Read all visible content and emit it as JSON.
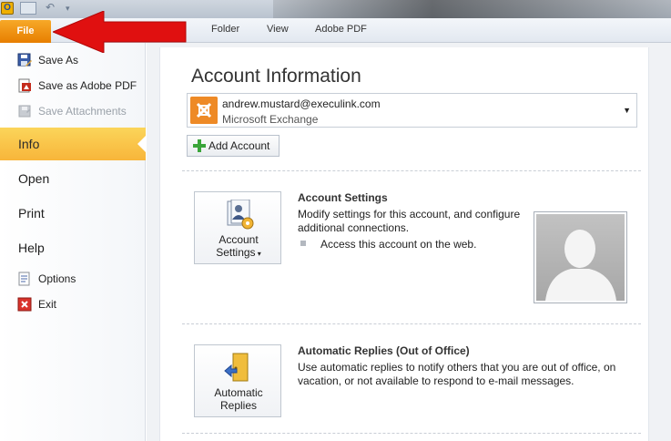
{
  "quick_access": {
    "app_logo": "O",
    "icons": [
      "outlook-icon",
      "save-icon",
      "undo-icon",
      "customize-dropdown-icon"
    ]
  },
  "tabs": {
    "file": "File",
    "folder": "Folder",
    "view": "View",
    "adobe_pdf": "Adobe PDF"
  },
  "sidebar": {
    "items": [
      {
        "label": "Save As",
        "icon": "save-as-icon"
      },
      {
        "label": "Save as Adobe PDF",
        "icon": "adobe-pdf-icon"
      },
      {
        "label": "Save Attachments",
        "icon": "save-attachments-icon",
        "disabled": true
      }
    ],
    "nav": {
      "info": "Info",
      "open": "Open",
      "print": "Print",
      "help": "Help"
    },
    "options": "Options",
    "exit": "Exit"
  },
  "main": {
    "title": "Account Information",
    "account": {
      "email": "andrew.mustard@execulink.com",
      "type": "Microsoft Exchange"
    },
    "add_account": "Add Account",
    "account_settings": {
      "button_line1": "Account",
      "button_line2": "Settings",
      "title": "Account Settings",
      "description": "Modify settings for this account, and configure additional connections.",
      "bullet": "Access this account on the web."
    },
    "automatic_replies": {
      "button_line1": "Automatic",
      "button_line2": "Replies",
      "title": "Automatic Replies (Out of Office)",
      "description": "Use automatic replies to notify others that you are out of office, on vacation, or not available to respond to e-mail messages."
    }
  },
  "colors": {
    "file_tab": "#e98b10",
    "info_selected": "#f9c143",
    "annotation_arrow": "#e01010"
  }
}
